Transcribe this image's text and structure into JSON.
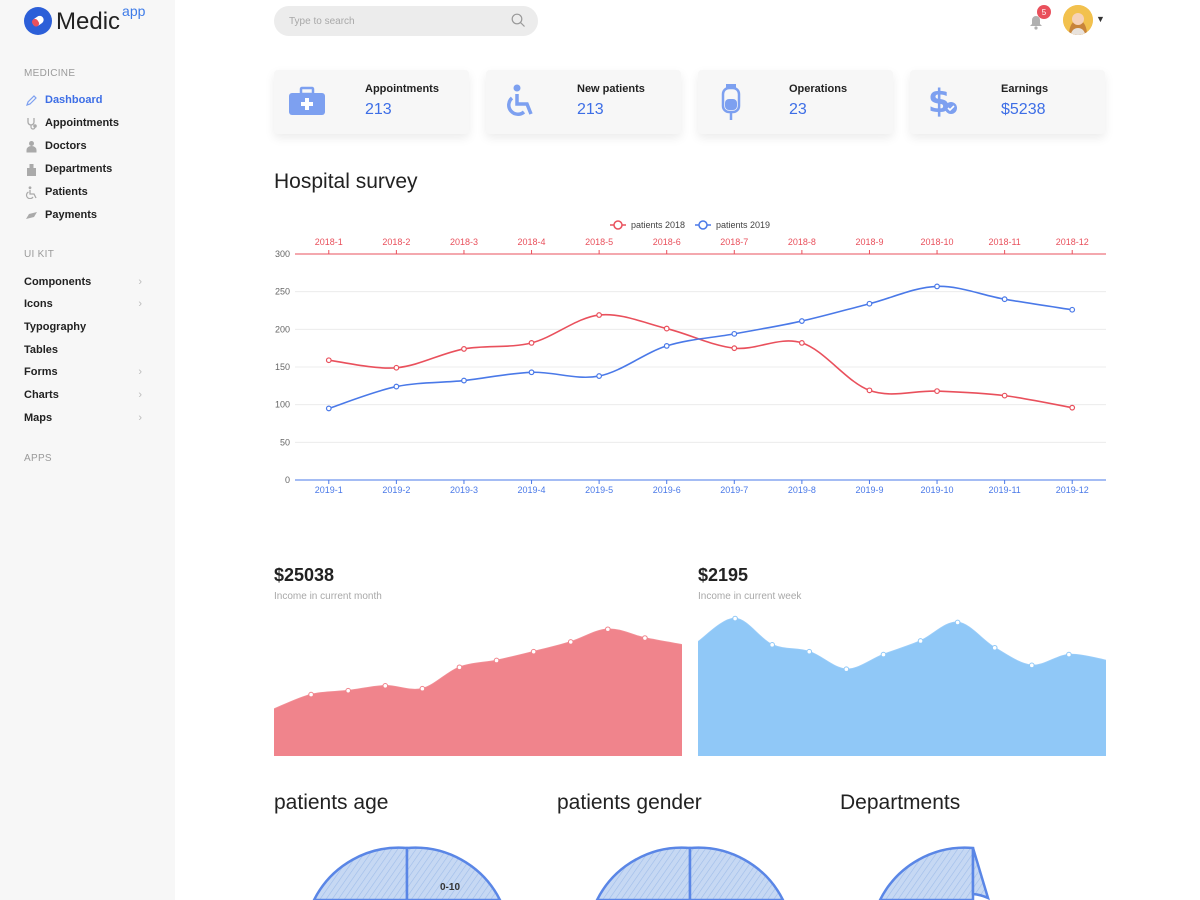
{
  "brand": {
    "name": "Medic",
    "sup": "app"
  },
  "sidebar": {
    "medicine_label": "MEDICINE",
    "items": [
      {
        "label": "Dashboard",
        "icon": "pen-icon",
        "active": true
      },
      {
        "label": "Appointments",
        "icon": "stethoscope-icon"
      },
      {
        "label": "Doctors",
        "icon": "doctor-icon"
      },
      {
        "label": "Departments",
        "icon": "building-icon"
      },
      {
        "label": "Patients",
        "icon": "wheelchair-icon"
      },
      {
        "label": "Payments",
        "icon": "card-icon"
      }
    ],
    "uikit_label": "UI KIT",
    "kit_items": [
      {
        "label": "Components",
        "chevron": true
      },
      {
        "label": "Icons",
        "chevron": true
      },
      {
        "label": "Typography",
        "chevron": false
      },
      {
        "label": "Tables",
        "chevron": false
      },
      {
        "label": "Forms",
        "chevron": true
      },
      {
        "label": "Charts",
        "chevron": true
      },
      {
        "label": "Maps",
        "chevron": true
      }
    ],
    "apps_label": "APPS"
  },
  "header": {
    "search_placeholder": "Type to search",
    "notifications_count": "5"
  },
  "stats": [
    {
      "label": "Appointments",
      "value": "213",
      "icon": "first-aid-kit-icon"
    },
    {
      "label": "New patients",
      "value": "213",
      "icon": "wheelchair-icon"
    },
    {
      "label": "Operations",
      "value": "23",
      "icon": "iv-bag-icon"
    },
    {
      "label": "Earnings",
      "value": "$5238",
      "icon": "dollar-icon"
    }
  ],
  "survey": {
    "title": "Hospital survey"
  },
  "income": {
    "month_value": "$25038",
    "month_label": "Income in current month",
    "week_value": "$2195",
    "week_label": "Income in current week"
  },
  "sections": {
    "age": "patients age",
    "gender": "patients gender",
    "departments": "Departments",
    "age_slice_label": "0-10"
  },
  "colors": {
    "accent": "#3d6ee6",
    "red": "#e9505c",
    "blue": "#4a79e8"
  },
  "chart_data": [
    {
      "type": "line",
      "title": "Hospital survey",
      "ylim": [
        0,
        300
      ],
      "yticks": [
        0,
        50,
        100,
        150,
        200,
        250,
        300
      ],
      "legend_position": "top",
      "grid": true,
      "series": [
        {
          "name": "patients 2018",
          "color": "#e9505c",
          "x": [
            "2018-1",
            "2018-2",
            "2018-3",
            "2018-4",
            "2018-5",
            "2018-6",
            "2018-7",
            "2018-8",
            "2018-9",
            "2018-10",
            "2018-11",
            "2018-12"
          ],
          "values": [
            159,
            149,
            174,
            182,
            219,
            201,
            175,
            182,
            119,
            118,
            112,
            96
          ]
        },
        {
          "name": "patients 2019",
          "color": "#4a79e8",
          "x": [
            "2019-1",
            "2019-2",
            "2019-3",
            "2019-4",
            "2019-5",
            "2019-6",
            "2019-7",
            "2019-8",
            "2019-9",
            "2019-10",
            "2019-11",
            "2019-12"
          ],
          "values": [
            95,
            124,
            132,
            143,
            138,
            178,
            194,
            211,
            234,
            257,
            240,
            226
          ]
        }
      ]
    },
    {
      "type": "area",
      "color": "#f0848c",
      "values": [
        48,
        63,
        67,
        72,
        69,
        91,
        98,
        107,
        117,
        130,
        121,
        114
      ]
    },
    {
      "type": "area",
      "color": "#90c8f7",
      "values": [
        117,
        141,
        114,
        107,
        89,
        104,
        118,
        137,
        111,
        93,
        104,
        98
      ]
    }
  ]
}
